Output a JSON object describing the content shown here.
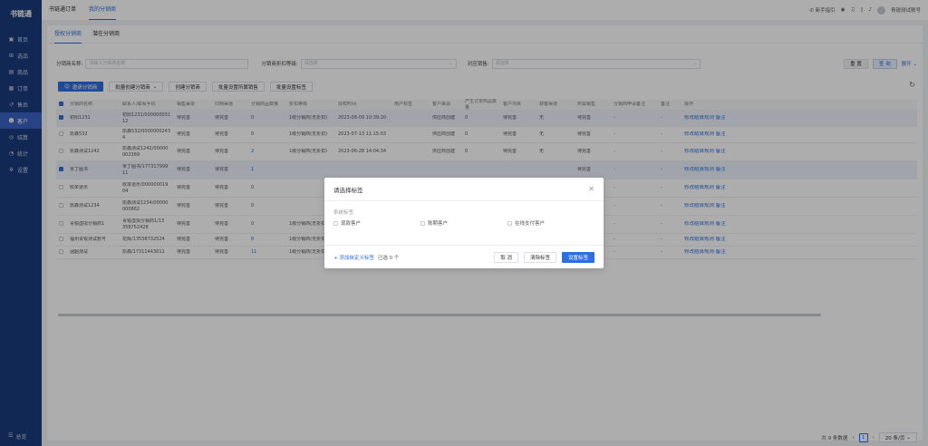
{
  "app": {
    "logo": "书链通"
  },
  "sidebar": {
    "items": [
      {
        "label": "首页",
        "icon": "home-icon",
        "glyph": "▣"
      },
      {
        "label": "选品",
        "icon": "select-icon",
        "glyph": "⊞"
      },
      {
        "label": "商品",
        "icon": "goods-icon",
        "glyph": "▤"
      },
      {
        "label": "订单",
        "icon": "order-icon",
        "glyph": "▦"
      },
      {
        "label": "售后",
        "icon": "aftersale-icon",
        "glyph": "↺"
      },
      {
        "label": "客户",
        "icon": "customer-icon",
        "glyph": "☻"
      },
      {
        "label": "结算",
        "icon": "settle-icon",
        "glyph": "◎"
      },
      {
        "label": "统计",
        "icon": "stats-icon",
        "glyph": "◔"
      },
      {
        "label": "设置",
        "icon": "settings-icon",
        "glyph": "✲"
      }
    ],
    "active": 5,
    "footer": "总览"
  },
  "topbar": {
    "tabs": [
      "书链通订单",
      "我的分销商"
    ],
    "active": 1,
    "guide": "新手指引",
    "account": "青锐测试账号"
  },
  "subtabs": [
    "授权分销商",
    "潜在分销商"
  ],
  "filters": {
    "name_label": "分销商名称:",
    "name_placeholder": "请输入分销商名称",
    "level_label": "分销商折扣等级:",
    "level_placeholder": "请选择",
    "sales_label": "对应销售:",
    "sales_placeholder": "请选择",
    "reset": "重 置",
    "query": "查 询",
    "expand": "展开"
  },
  "actions": [
    "邀请分销商",
    "批量创建分销商",
    "创建分销商",
    "批量设置所属销售",
    "批量设置标签"
  ],
  "table": {
    "headers": [
      "分销商名称",
      "联系人/联系手机",
      "销售渠道",
      "归档渠道",
      "分销商品数量",
      "折扣等级",
      "授权时间",
      "用户标签",
      "客户来源",
      "产生订单商品数量",
      "客户项目",
      "获客渠道",
      "所属销售",
      "分销商申请备注",
      "备注",
      "操作"
    ],
    "rows": [
      {
        "sel": true,
        "cells": [
          "初阳1231",
          "初阳1231/000000031 12",
          "待完善",
          "待完善",
          "0",
          "1级分销商(无折扣)",
          "2023-08-09 10:39:20",
          "",
          "供应商创建",
          "0",
          "待完善",
          "无",
          "待完善",
          "-",
          "-"
        ]
      },
      {
        "sel": false,
        "cells": [
          "凯森532",
          "凯森532/0000000243 4",
          "待完善",
          "待完善",
          "0",
          "1级分销商(无折扣)",
          "2023-07-13 11:15:03",
          "",
          "供应商创建",
          "0",
          "待完善",
          "无",
          "待完善",
          "-",
          "-"
        ]
      },
      {
        "sel": false,
        "cells": [
          "凯森测试1242",
          "凯森测试1242/00000 002369",
          "待完善",
          "待完善",
          "2",
          "1级分销商(无折扣)",
          "2023-06-28 14:04:34",
          "",
          "供应商创建",
          "0",
          "待完善",
          "无",
          "待完善",
          "-",
          "-"
        ]
      },
      {
        "sel": true,
        "cells": [
          "米丁图书",
          "米丁图书/177317999 11",
          "待完善",
          "待完善",
          "1",
          "",
          "",
          "",
          "",
          "",
          "",
          "",
          "待完善",
          "-",
          "-"
        ]
      },
      {
        "sel": false,
        "cells": [
          "收单道示",
          "收单道示/000000019 04",
          "待完善",
          "待完善",
          "0",
          "",
          "",
          "",
          "",
          "",
          "",
          "",
          "待完善",
          "-",
          "-"
        ]
      },
      {
        "sel": false,
        "cells": [
          "凯森测试1234",
          "凯森测试1234/00000 000862",
          "待完善",
          "待完善",
          "0",
          "",
          "",
          "",
          "",
          "",
          "",
          "",
          "待完善",
          "-",
          "-"
        ]
      },
      {
        "sel": false,
        "cells": [
          "青锐虚拟分销商1",
          "青锐虚拟分销商1/13 358752428",
          "待完善",
          "待完善",
          "0",
          "1级分销商(无折扣)",
          "2023-04-18 15:00:22",
          "",
          "",
          "",
          "",
          "",
          "待完善",
          "-",
          "-"
        ]
      },
      {
        "sel": false,
        "cells": [
          "福州青锐测试账号",
          "花辉/13558732524",
          "待完善",
          "待完善",
          "8",
          "1级分销商(无折扣)",
          "2023-04-18 15:03:22",
          "",
          "渠道授权",
          "6",
          "待完善",
          "无",
          "待完善",
          "-",
          "-"
        ]
      },
      {
        "sel": false,
        "cells": [
          "涵超测试",
          "凯森/17311443011",
          "待完善",
          "待完善",
          "11",
          "1级分销商(无折扣)",
          "2023-04-18 14:26:59",
          "",
          "渠道授权",
          "9",
          "待完善",
          "无",
          "待完善",
          "-",
          "-"
        ]
      }
    ],
    "op_edit": "修改结算规则",
    "op_note": "备注"
  },
  "pager": {
    "total": "共 9 条数据",
    "page": "1",
    "size": "20 条/页"
  },
  "modal": {
    "title": "请选择标签",
    "section": "系统标签",
    "options": [
      "现款客户",
      "账期客户",
      "在线支付客户"
    ],
    "add_custom": "+ 添加自定义标签",
    "selected": "已选 0 个",
    "cancel": "取 消",
    "clear": "清除标签",
    "confirm": "设置标签"
  },
  "colors": {
    "sidebar": "#1a3a7c",
    "accent": "#2d6fe0",
    "sidebar_active": "#3b63c4"
  }
}
